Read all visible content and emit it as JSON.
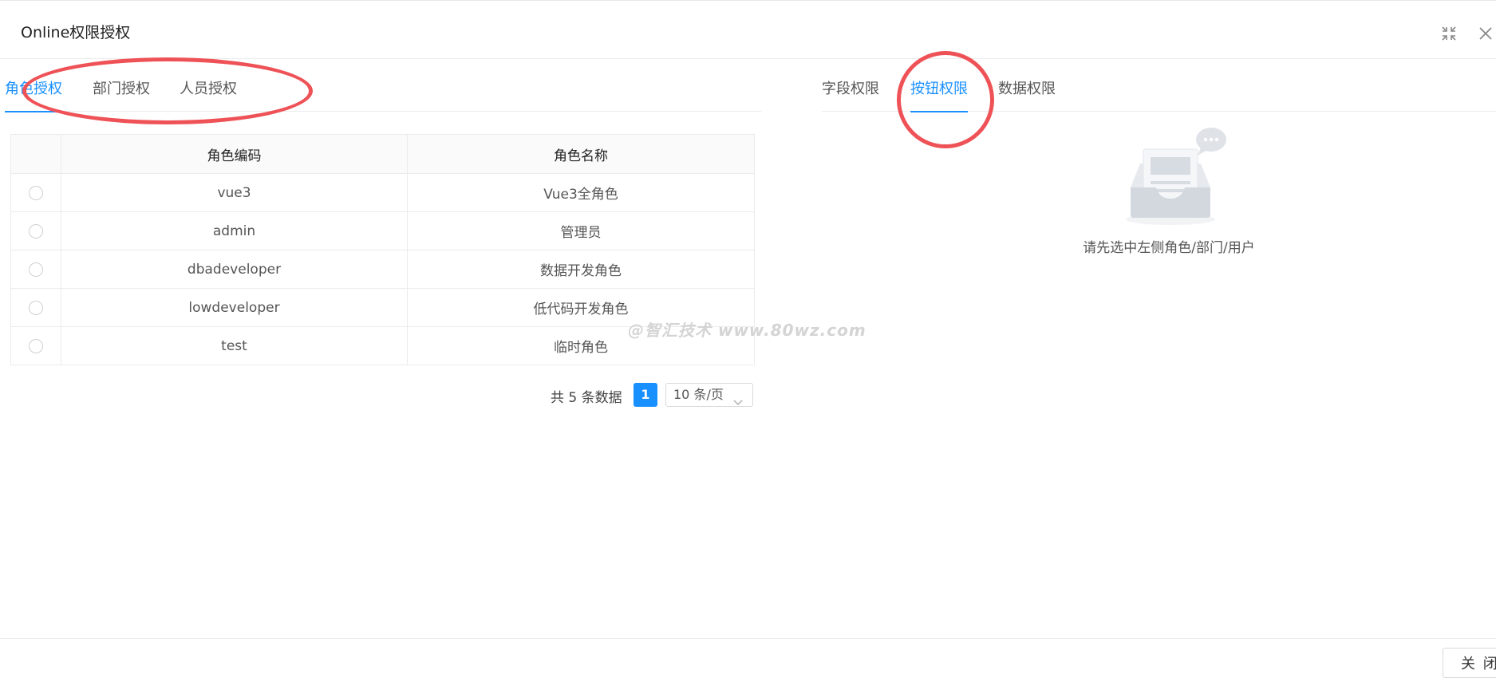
{
  "dialog": {
    "title": "Online权限授权"
  },
  "left_tabs": [
    {
      "label": "角色授权",
      "active": true
    },
    {
      "label": "部门授权",
      "active": false
    },
    {
      "label": "人员授权",
      "active": false
    }
  ],
  "right_tabs": [
    {
      "label": "字段权限",
      "active": false
    },
    {
      "label": "按钮权限",
      "active": true
    },
    {
      "label": "数据权限",
      "active": false
    }
  ],
  "table": {
    "columns": [
      "角色编码",
      "角色名称"
    ],
    "rows": [
      {
        "code": "vue3",
        "name": "Vue3全角色"
      },
      {
        "code": "admin",
        "name": "管理员"
      },
      {
        "code": "dbadeveloper",
        "name": "数据开发角色"
      },
      {
        "code": "lowdeveloper",
        "name": "低代码开发角色"
      },
      {
        "code": "test",
        "name": "临时角色"
      }
    ]
  },
  "pagination": {
    "total_text": "共 5 条数据",
    "current_page": "1",
    "page_size": "10 条/页"
  },
  "empty_state": {
    "text": "请先选中左侧角色/部门/用户"
  },
  "watermark": "@智汇技术 www.80wz.com",
  "footer": {
    "close_label": "关 闭"
  },
  "colors": {
    "accent": "#1890ff",
    "annotation": "#ee5257"
  },
  "icons": [
    "fullscreen-exit-icon",
    "close-icon",
    "chevron-down-icon",
    "empty-inbox-icon"
  ]
}
